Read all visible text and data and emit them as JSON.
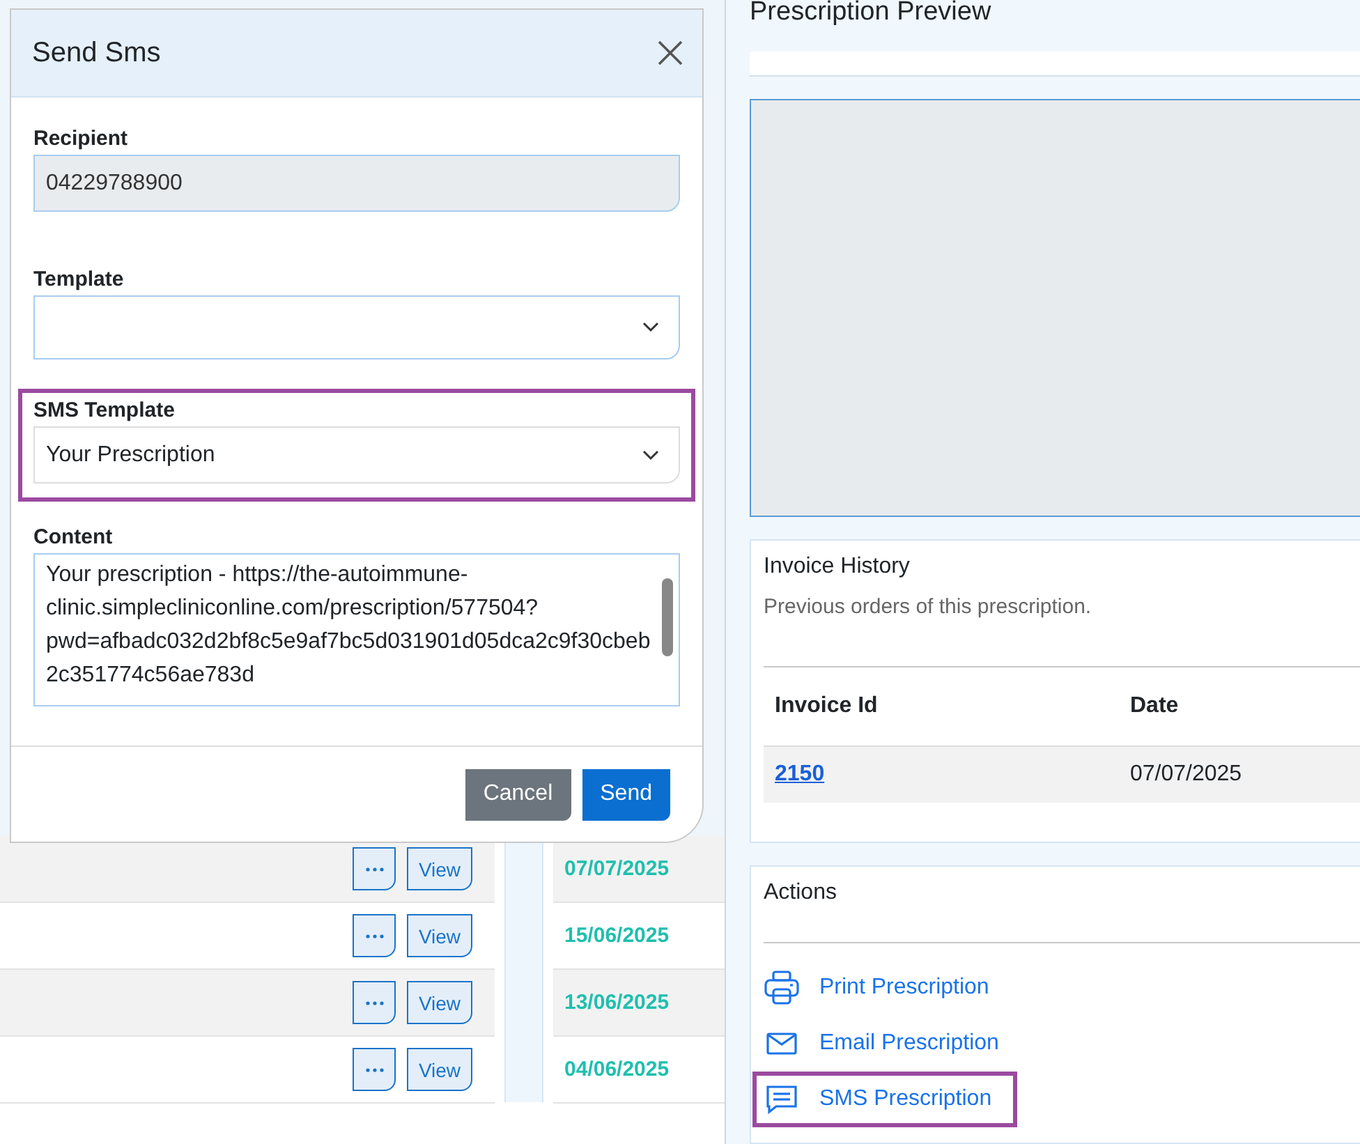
{
  "modal": {
    "title": "Send Sms",
    "fields": [
      {
        "kind": "input",
        "label": "Recipient",
        "value": "04229788900",
        "disabled": true,
        "highlighted": false
      },
      {
        "kind": "select",
        "label": "Template",
        "highlighted": false
      },
      {
        "kind": "select",
        "label": "SMS Template",
        "value": "Your Prescription",
        "highlighted": true
      },
      {
        "kind": "textarea",
        "label": "Content",
        "value": "Your prescription - https://the-autoimmune-clinic.simplecliniconline.com/prescription/577504?pwd=afbadc032d2bf8c5e9af7bc5d031901d05dca2c9f30cbeb2c351774c56ae783d",
        "highlighted": false
      }
    ],
    "buttons": [
      {
        "label": "Cancel",
        "kind": "secondary"
      },
      {
        "label": "Send",
        "kind": "primary"
      }
    ]
  },
  "rows": [
    {
      "action": "View",
      "date": "07/07/2025"
    },
    {
      "action": "View",
      "date": "15/06/2025"
    },
    {
      "action": "View",
      "date": "13/06/2025"
    },
    {
      "action": "View",
      "date": "04/06/2025"
    }
  ],
  "preview": {
    "title": "Prescription Preview"
  },
  "invoice_history": {
    "title": "Invoice History",
    "description": "Previous orders of this prescription.",
    "columns": [
      "Invoice Id",
      "Date"
    ],
    "rows": [
      {
        "invoice_id": "2150",
        "date": "07/07/2025"
      }
    ]
  },
  "actions": {
    "title": "Actions",
    "items": [
      {
        "kind": "print",
        "label": "Print Prescription",
        "highlighted": false
      },
      {
        "kind": "email",
        "label": "Email Prescription",
        "highlighted": false
      },
      {
        "kind": "sms",
        "label": "SMS Prescription",
        "highlighted": true
      }
    ]
  }
}
